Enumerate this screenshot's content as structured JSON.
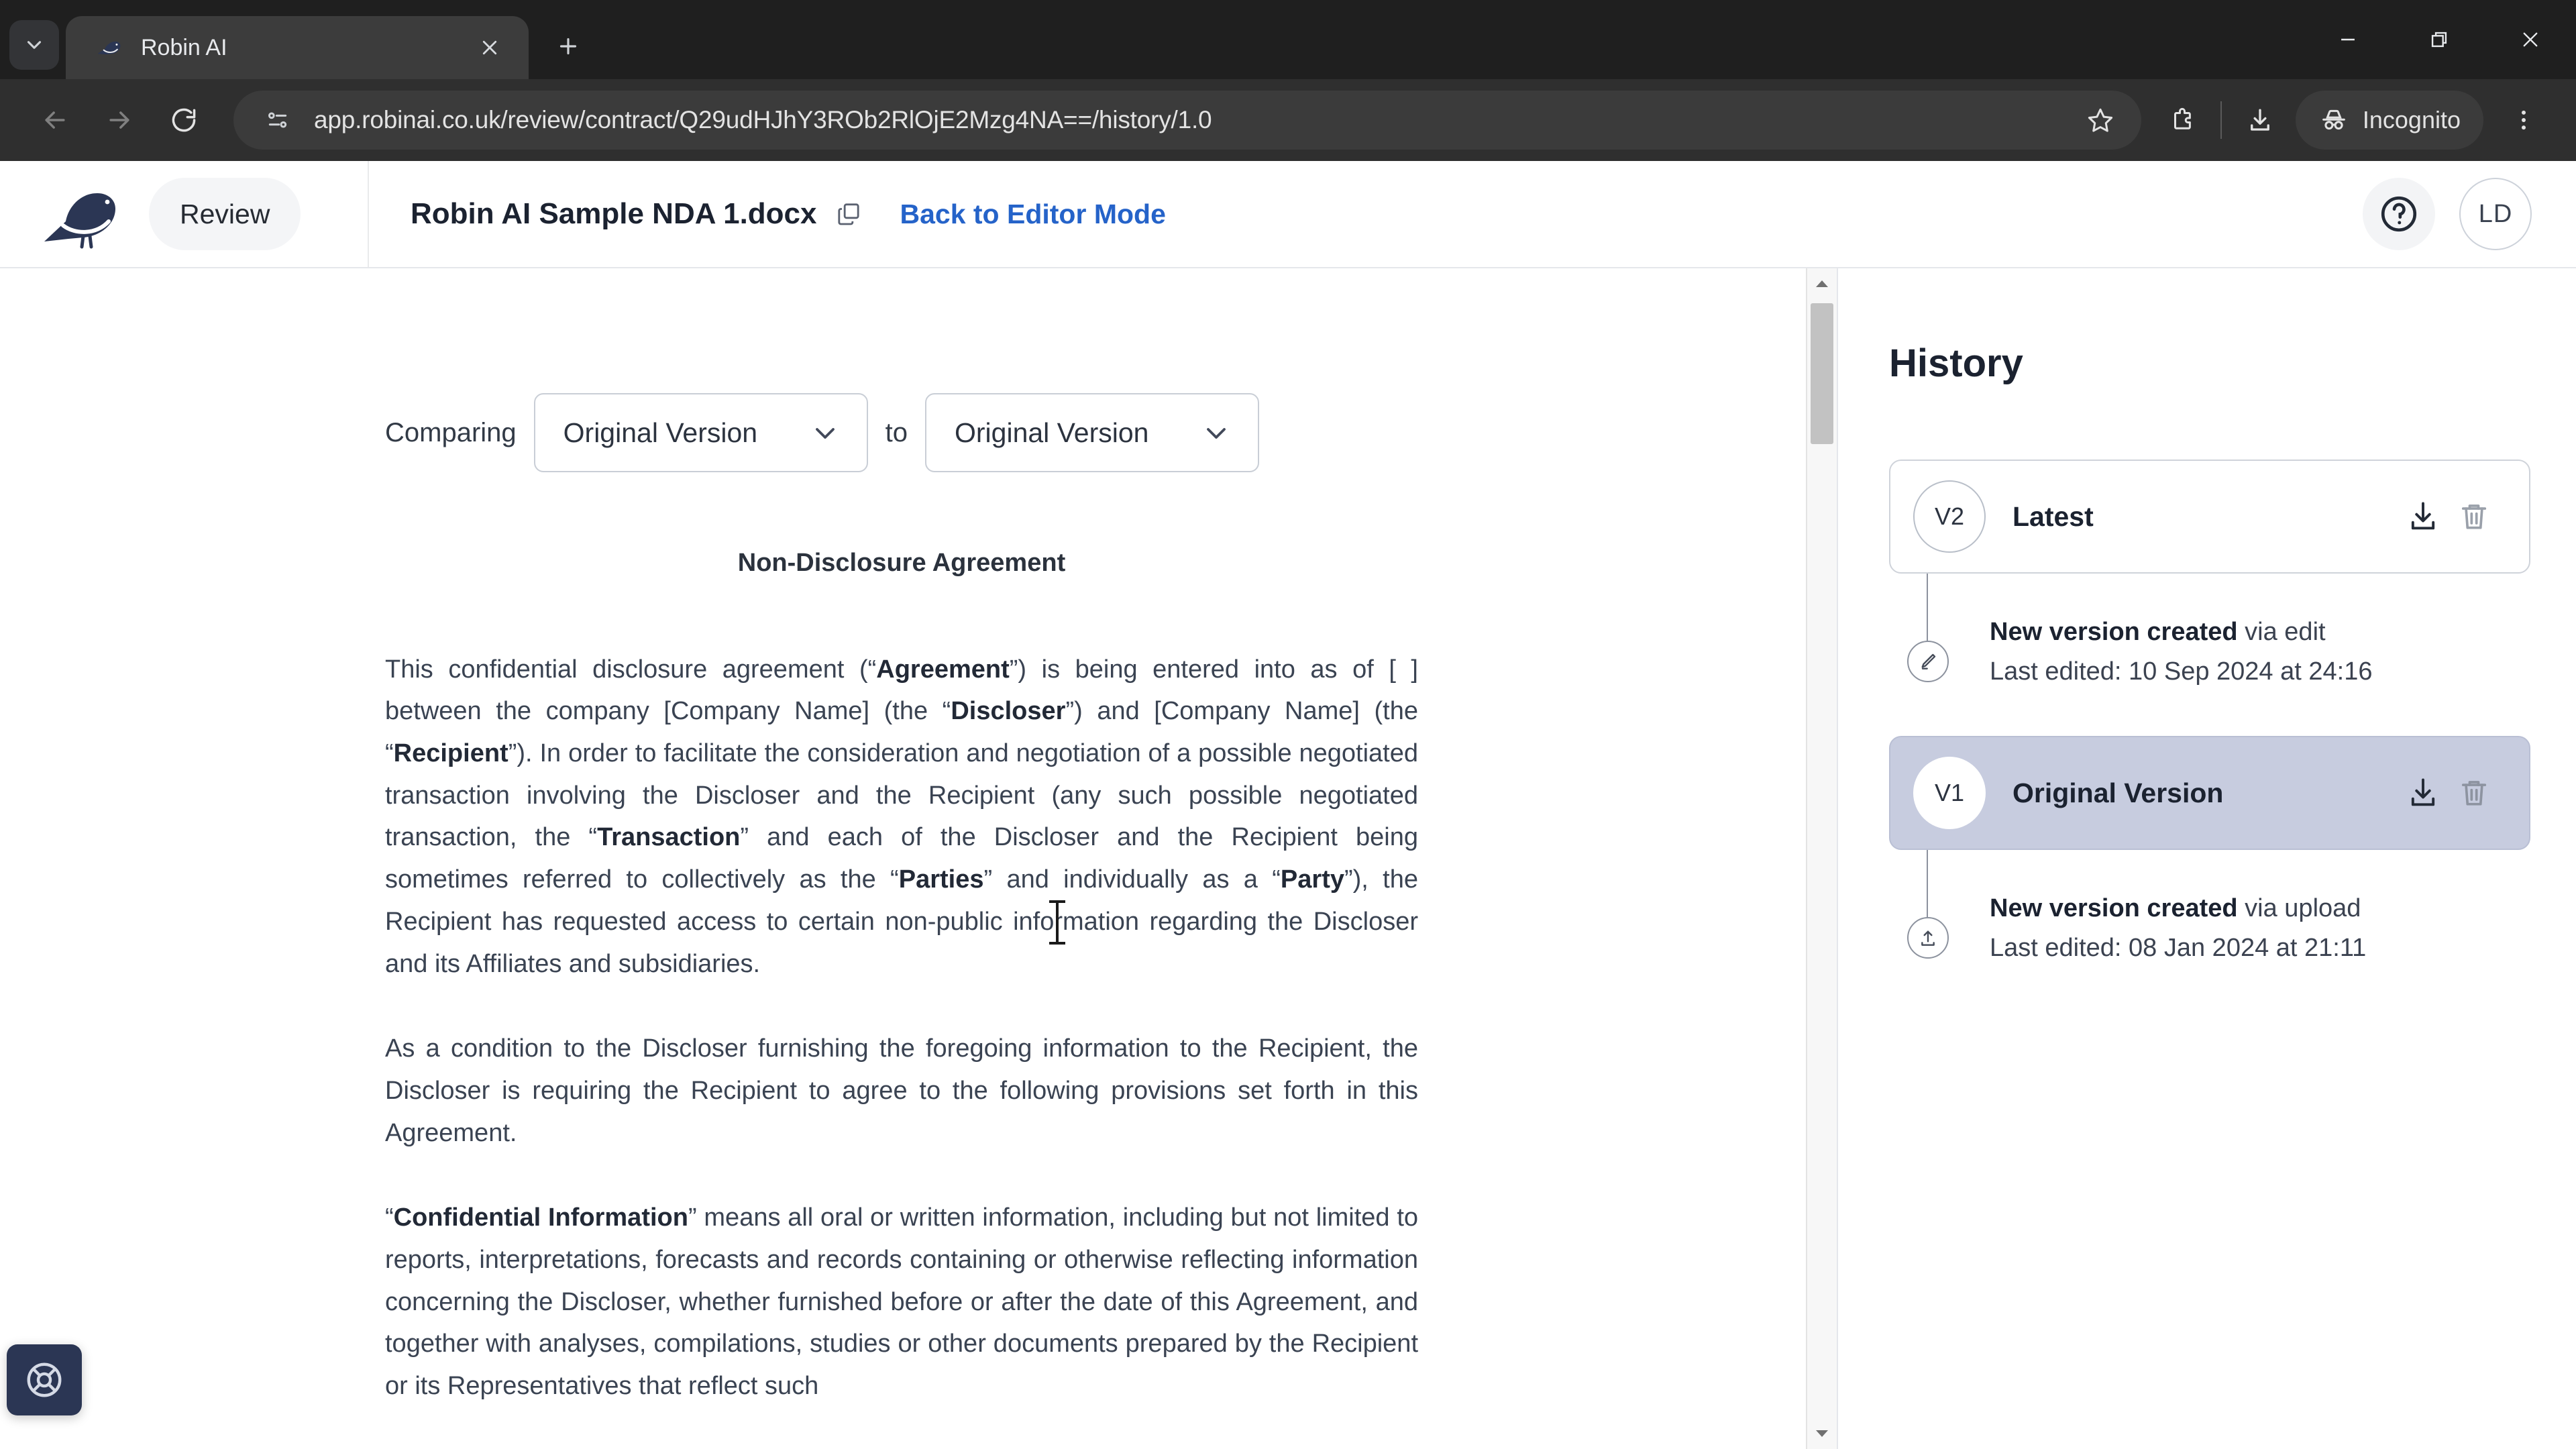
{
  "browser": {
    "tab": {
      "title": "Robin AI",
      "favicon_icon": "robin-bird-favicon"
    },
    "tab_list_icon": "chevron-down-icon",
    "new_tab_icon": "plus-icon",
    "window_controls": {
      "minimize_icon": "minimize-icon",
      "maximize_icon": "restore-icon",
      "close_icon": "close-icon"
    },
    "nav": {
      "back_icon": "arrow-left-icon",
      "forward_icon": "arrow-right-icon",
      "reload_icon": "reload-icon"
    },
    "omnibox": {
      "site_info_icon": "page-info-icon",
      "url": "app.robinai.co.uk/review/contract/Q29udHJhY3ROb2RlOjE2Mzg4NA==/history/1.0",
      "bookmark_icon": "star-icon",
      "extensions_icon": "puzzle-icon"
    },
    "downloads_icon": "download-icon",
    "incognito": {
      "label": "Incognito",
      "icon": "incognito-icon"
    },
    "menu_icon": "kebab-menu-icon"
  },
  "app_header": {
    "logo_icon": "robin-ai-bird-logo",
    "mode_pill": "Review",
    "document_title": "Robin AI Sample NDA 1.docx",
    "copy_icon": "copy-icon",
    "editor_link": "Back to Editor Mode",
    "help_icon": "help-circle-icon",
    "avatar_initials": "LD"
  },
  "compare": {
    "label": "Comparing",
    "joiner": "to",
    "left_version": "Original Version",
    "right_version": "Original Version",
    "chevron_icon": "chevron-down-icon"
  },
  "document": {
    "heading": "Non-Disclosure Agreement",
    "paragraphs": [
      "This confidential disclosure agreement (“Agreement”) is being entered into as of [ ] between the company [Company Name] (the “Discloser”) and [Company Name] (the “Recipient”). In order to facilitate the consideration and negotiation of a possible negotiated transaction involving the Discloser and the Recipient (any such possible negotiated transaction, the “Transaction” and each of the Discloser and the Recipient being sometimes referred to collectively as the “Parties” and individually as a “Party”), the Recipient has requested access to certain non-public information regarding the Discloser and its Affiliates and subsidiaries.",
      "As a condition to the Discloser furnishing the foregoing information to the Recipient, the Discloser is requiring the Recipient to agree to the following provisions set forth in this Agreement.",
      "“Confidential Information” means all oral or written information, including but not limited to reports, interpretations, forecasts and records containing or otherwise reflecting information concerning the Discloser, whether furnished before or after the date of this Agreement, and together with analyses, compilations, studies or other documents prepared by the Recipient or its Representatives that reflect such"
    ],
    "scrollbar": {
      "up_arrow_icon": "scroll-up-arrow-icon",
      "down_arrow_icon": "scroll-down-arrow-icon"
    }
  },
  "history": {
    "title": "History",
    "versions": [
      {
        "badge": "V2",
        "name": "Latest",
        "selected": false,
        "download_icon": "download-icon",
        "delete_icon": "trash-icon",
        "event_bold": "New version created",
        "event_rest": " via edit",
        "event_icon": "pencil-icon",
        "last_edited": "Last edited: 10 Sep 2024 at 24:16"
      },
      {
        "badge": "V1",
        "name": "Original Version",
        "selected": true,
        "download_icon": "download-icon",
        "delete_icon": "trash-icon",
        "event_bold": "New version created",
        "event_rest": " via upload",
        "event_icon": "upload-icon",
        "last_edited": "Last edited: 08 Jan 2024 at 21:11"
      }
    ]
  },
  "support_widget": {
    "icon": "lifebuoy-icon"
  },
  "colors": {
    "brand_navy": "#2b3654",
    "link_blue": "#2563c9",
    "selected_version": "#c7ccdf",
    "chrome_dark": "#2f2f2f",
    "tabstrip_dark": "#1f1f1f"
  }
}
